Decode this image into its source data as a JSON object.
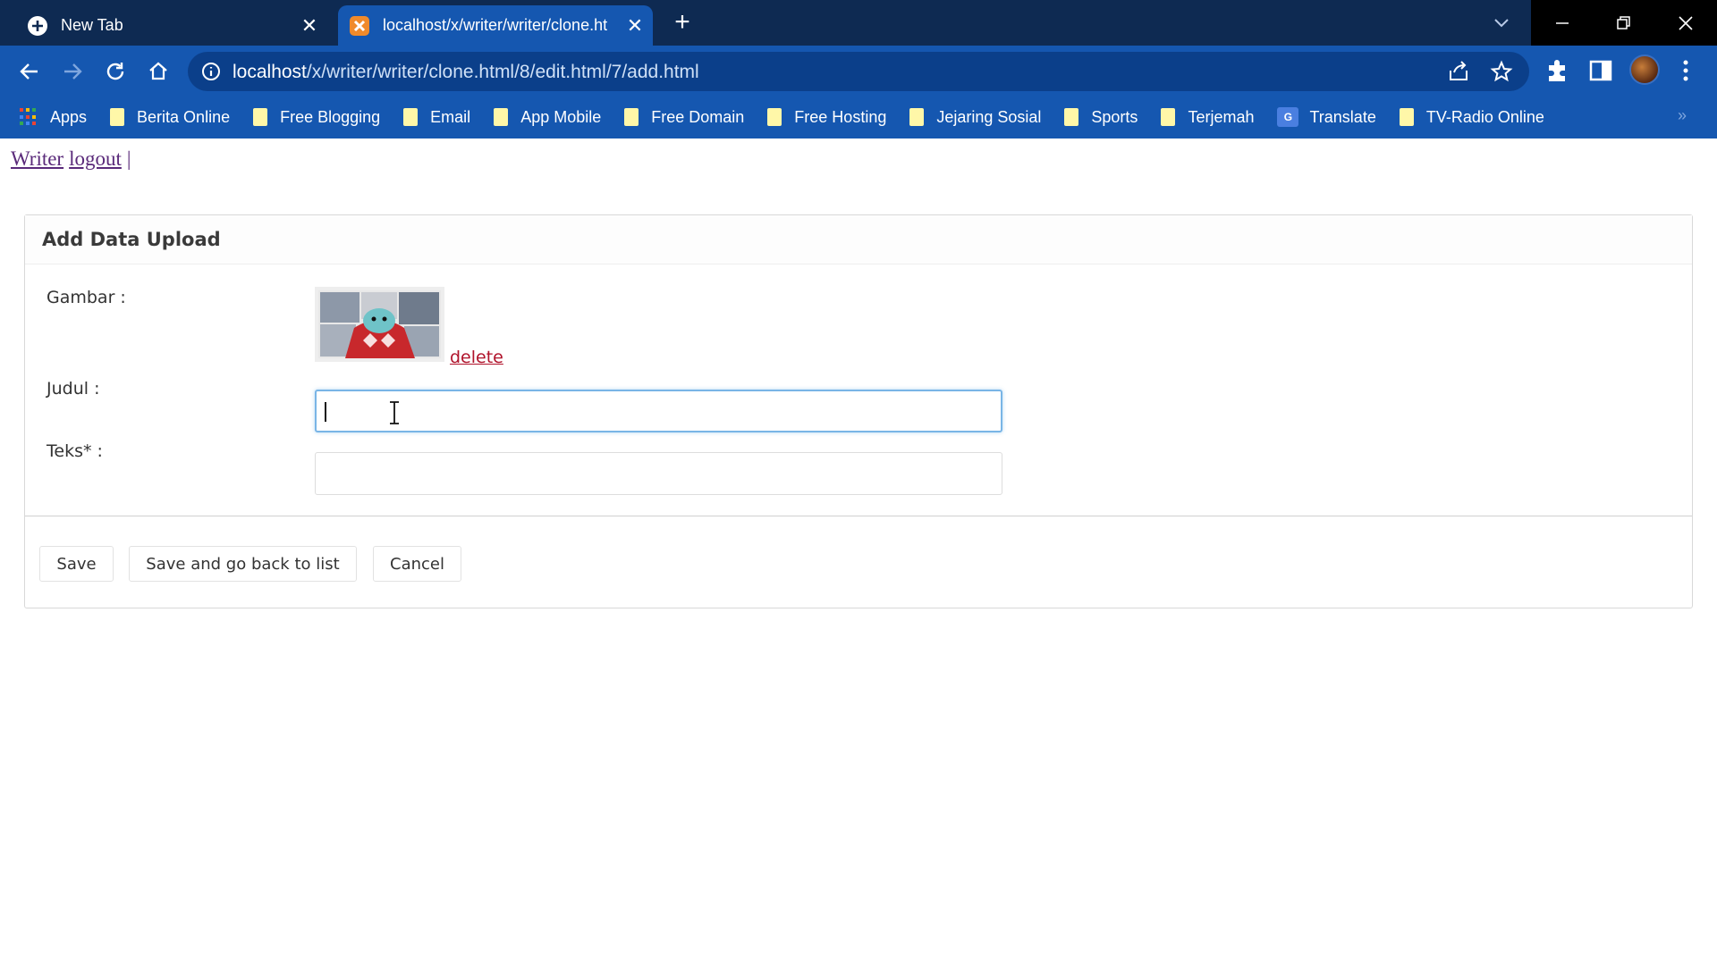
{
  "browser": {
    "tabs": [
      {
        "title": "New Tab",
        "active": false
      },
      {
        "title": "localhost/x/writer/writer/clone.ht",
        "active": true
      }
    ],
    "url_host": "localhost",
    "url_path": "/x/writer/writer/clone.html/8/edit.html/7/add.html",
    "bookmarks": {
      "apps": "Apps",
      "items": [
        "Berita Online",
        "Free Blogging",
        "Email",
        "App Mobile",
        "Free Domain",
        "Free Hosting",
        "Jejaring Sosial",
        "Sports",
        "Terjemah",
        "Translate",
        "TV-Radio Online"
      ]
    },
    "overflow": "»"
  },
  "page": {
    "links": {
      "writer": "Writer",
      "logout": "logout",
      "separator": "|"
    },
    "form": {
      "title": "Add Data Upload",
      "gambar_label": "Gambar :",
      "delete_label": "delete",
      "judul_label": "Judul :",
      "judul_value": "",
      "teks_label": "Teks* :",
      "teks_value": "",
      "buttons": {
        "save": "Save",
        "save_back": "Save and go back to list",
        "cancel": "Cancel"
      }
    }
  },
  "colors": {
    "tabstrip": "#0e2a52",
    "toolbar": "#1557b0",
    "delete_link": "#b0122a",
    "visited_link": "#5a2a7a"
  }
}
